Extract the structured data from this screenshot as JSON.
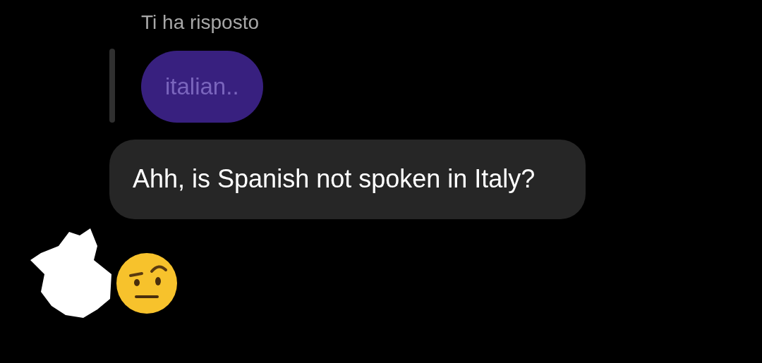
{
  "reply_header": "Ti ha risposto",
  "quoted_message": "italian..",
  "message": "Ahh, is Spanish not spoken in Italy?"
}
